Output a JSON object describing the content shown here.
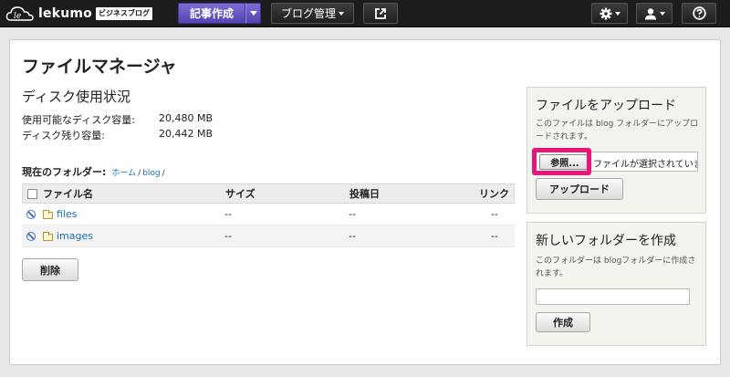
{
  "colors": {
    "accent": "#5344b3",
    "highlight": "#e8157a",
    "link": "#1a6fb5",
    "topbar": "#1c1c1c"
  },
  "topbar": {
    "logo_text": "lekumo",
    "logo_badge": "ビジネスブログ",
    "new_post": "記事作成",
    "blog_manage": "ブログ管理",
    "external_icon": "external-link-icon",
    "settings_icon": "gear-icon",
    "user_icon": "user-icon",
    "help_icon": "help-icon"
  },
  "main": {
    "title": "ファイルマネージャ",
    "disk": {
      "heading": "ディスク使用状況",
      "available_label": "使用可能なディスク容量:",
      "available_value": "20,480 MB",
      "remaining_label": "ディスク残り容量:",
      "remaining_value": "20,442 MB"
    },
    "current_folder_label": "現在のフォルダー:",
    "breadcrumb": {
      "home": "ホーム",
      "sep": "/",
      "blog": "blog",
      "trail": "/"
    },
    "table": {
      "headers": {
        "name": "ファイル名",
        "size": "サイズ",
        "date": "投稿日",
        "link": "リンク"
      },
      "rows": [
        {
          "name": "files",
          "size": "--",
          "date": "--",
          "link": "--"
        },
        {
          "name": "images",
          "size": "--",
          "date": "--",
          "link": "--"
        }
      ]
    },
    "delete_button": "削除"
  },
  "upload": {
    "title": "ファイルをアップロード",
    "desc": "このファイルは blog フォルダーにアップロードされます。",
    "browse": "参照...",
    "no_file": "ファイルが選択されていませ",
    "upload_button": "アップロード"
  },
  "new_folder": {
    "title": "新しいフォルダーを作成",
    "desc": "このフォルダーは blogフォルダーに作成されます。",
    "create_button": "作成"
  }
}
